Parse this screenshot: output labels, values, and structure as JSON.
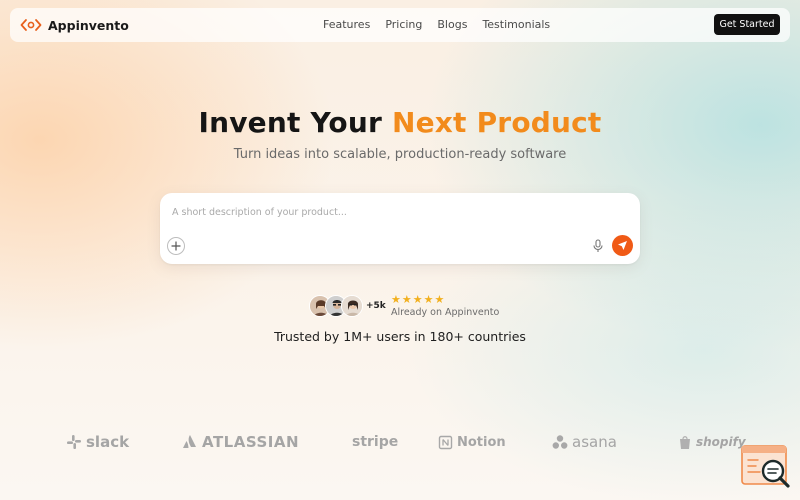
{
  "brand": {
    "name": "Appinvento",
    "icon": "code-brackets-icon",
    "accent": "#f28b1c"
  },
  "nav": {
    "links": [
      "Features",
      "Pricing",
      "Blogs",
      "Testimonials"
    ],
    "cta": "Get Started"
  },
  "hero": {
    "title_part1": "Invent Your",
    "title_part2": "Next Product",
    "subtitle": "Turn ideas into scalable, production-ready software"
  },
  "prompt": {
    "placeholder": "A short description of your product...",
    "value": "",
    "add_icon": "plus-icon",
    "mic_icon": "microphone-icon",
    "send_icon": "send-icon",
    "send_color": "#f05a16"
  },
  "social_proof": {
    "user_count": "+5k",
    "stars": "★★★★★",
    "rating_text": "Already on Appinvento",
    "trusted": "Trusted by 1M+ users in 180+ countries"
  },
  "logos": [
    "slack",
    "ATLASSIAN",
    "stripe",
    "Notion",
    "asana",
    "shopify"
  ],
  "widget": {
    "icon": "search-chat-icon"
  }
}
